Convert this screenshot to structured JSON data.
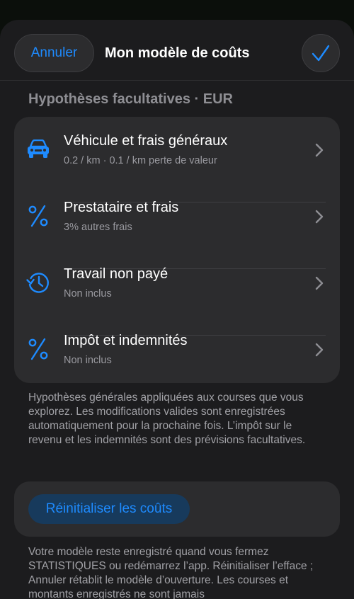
{
  "header": {
    "cancel_label": "Annuler",
    "title": "Mon modèle de coûts",
    "confirm_icon": "checkmark-icon"
  },
  "section": {
    "header": "Hypothèses facultatives · EUR"
  },
  "rows": [
    {
      "icon": "car-icon",
      "title": "Véhicule et frais généraux",
      "subtitle": "0.2 / km · 0.1 / km perte de valeur"
    },
    {
      "icon": "percent-icon",
      "title": "Prestataire et frais",
      "subtitle": "3% autres frais"
    },
    {
      "icon": "history-clock-icon",
      "title": "Travail non payé",
      "subtitle": "Non inclus"
    },
    {
      "icon": "percent-icon",
      "title": "Impôt et indemnités",
      "subtitle": "Non inclus"
    }
  ],
  "footer_note": "Hypothèses générales appliquées aux courses que vous explorez. Les modifications valides sont enregistrées automatiquement pour la prochaine fois. L’impôt sur le revenu et les indemnités sont des prévisions facultatives.",
  "reset": {
    "label": "Réinitialiser les coûts",
    "note": "Votre modèle reste enregistré quand vous fermez STATISTIQUES ou redémarrez l’app. Réinitialiser l’efface ; Annuler rétablit le modèle d’ouverture. Les courses et montants enregistrés ne sont jamais"
  },
  "colors": {
    "accent": "#1e8bff",
    "background": "#1c1c1e",
    "card": "#2c2c2e",
    "secondary_text": "#9a9aa0"
  }
}
